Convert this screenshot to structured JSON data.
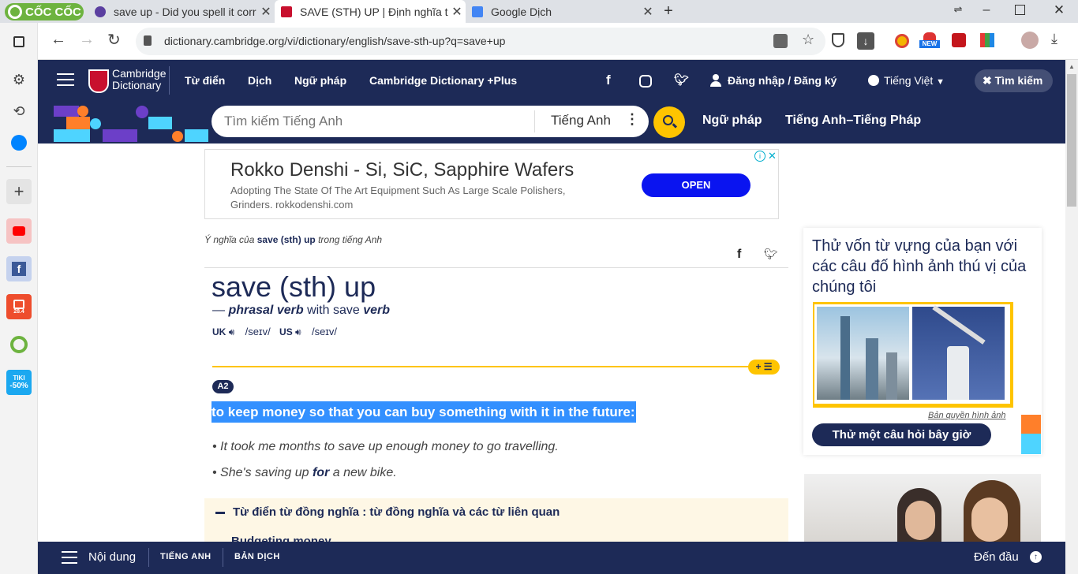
{
  "browser": {
    "brand": "CỐC CỐC",
    "tabs": [
      {
        "title": "save up - Did you spell it corr"
      },
      {
        "title": "SAVE (STH) UP | Định nghĩa tr"
      },
      {
        "title": "Google Dịch"
      }
    ],
    "url": "dictionary.cambridge.org/vi/dictionary/english/save-sth-up?q=save+up",
    "new_badge": "NEW"
  },
  "sidebar": {
    "shopee_badge": "28.4",
    "tiki_label": "TIKI",
    "tiki_discount": "-50%"
  },
  "nav": {
    "logo_line1": "Cambridge",
    "logo_line2": "Dictionary",
    "links": [
      "Từ điển",
      "Dịch",
      "Ngữ pháp",
      "Cambridge Dictionary +Plus"
    ],
    "login": "Đăng nhập / Đăng ký",
    "language": "Tiếng Việt",
    "search_button": "Tìm kiếm"
  },
  "search": {
    "placeholder": "Tìm kiếm Tiếng Anh",
    "dict_select": "Tiếng Anh",
    "links": [
      "Ngữ pháp",
      "Tiếng Anh–Tiếng Pháp"
    ]
  },
  "ad": {
    "title": "Rokko Denshi - Si, SiC, Sapphire Wafers",
    "text": "Adopting The State Of The Art Equipment Such As Large Scale Polishers, Grinders. rokkodenshi.com",
    "cta": "OPEN"
  },
  "entry": {
    "breadcrumb_prefix": "Ý nghĩa của",
    "breadcrumb_word": "save (sth) up",
    "breadcrumb_suffix": "trong tiếng Anh",
    "headword": "save (sth) up",
    "pos_dash": "—",
    "pos": "phrasal verb",
    "with_text": "with save",
    "with_pos": "verb",
    "uk_label": "UK",
    "uk_ipa": "/seɪv/",
    "us_label": "US",
    "us_ipa": "/seɪv/",
    "level": "A2",
    "definition": "to keep money so that you can buy something with it in the future:",
    "example1": "It took me months to save up enough money to go travelling.",
    "example2_pre": "She's saving up",
    "example2_bold": "for",
    "example2_post": "a new bike.",
    "thesaurus_title": "Từ điển từ đồng nghĩa : từ đồng nghĩa và các từ liên quan",
    "thesaurus_item": "Budgeting money"
  },
  "quiz": {
    "title": "Thử vốn từ vựng của bạn với các câu đố hình ảnh thú vị của chúng tôi",
    "credit": "Bản quyền hình ảnh",
    "button": "Thử một câu hỏi bây giờ"
  },
  "bottom": {
    "contents": "Nội dung",
    "tab1": "TIẾNG ANH",
    "tab2": "BẢN DỊCH",
    "top": "Đến đầu"
  },
  "colors": {
    "navy": "#1d2a57",
    "accent_yellow": "#fec400",
    "highlight": "#3390ff",
    "ad_button": "#0a14f0"
  }
}
